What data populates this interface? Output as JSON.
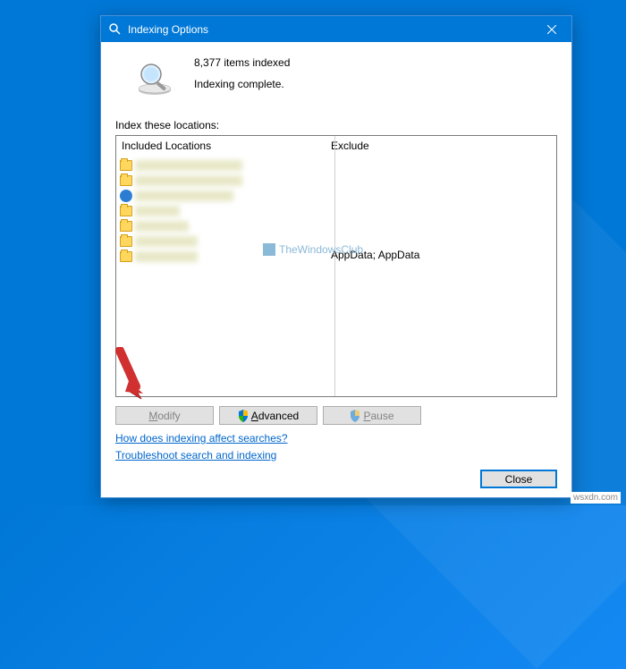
{
  "titlebar": {
    "title": "Indexing Options"
  },
  "status": {
    "items_indexed": "8,377 items indexed",
    "state": "Indexing complete."
  },
  "section_label": "Index these locations:",
  "columns": {
    "included": "Included Locations",
    "exclude": "Exclude"
  },
  "exclude_row": "AppData; AppData",
  "watermark": "TheWindowsClub",
  "buttons": {
    "modify": "Modify",
    "advanced": "Advanced",
    "pause": "Pause",
    "close": "Close"
  },
  "links": {
    "help": "How does indexing affect searches?",
    "troubleshoot": "Troubleshoot search and indexing"
  },
  "footer": "wsxdn.com"
}
